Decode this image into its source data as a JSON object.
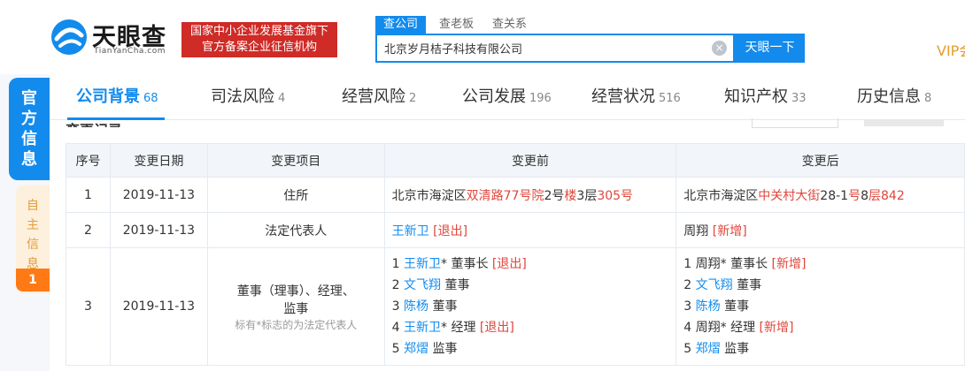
{
  "header": {
    "logo_text": "天眼查",
    "logo_sub": "TianYanCha.com",
    "badge_line1": "国家中小企业发展基金旗下",
    "badge_line2": "官方备案企业征信机构",
    "search_tabs": [
      "查公司",
      "查老板",
      "查关系"
    ],
    "search_value": "北京岁月桔子科技有限公司",
    "clear_icon": "×",
    "search_button": "天眼一下",
    "vip": "VIP会"
  },
  "side": {
    "official": [
      "官",
      "方",
      "信",
      "息"
    ],
    "self": [
      "自",
      "主",
      "信",
      "息"
    ],
    "self_count": "1"
  },
  "nav": [
    {
      "label": "公司背景",
      "count": "68"
    },
    {
      "label": "司法风险",
      "count": "4"
    },
    {
      "label": "经营风险",
      "count": "2"
    },
    {
      "label": "公司发展",
      "count": "196"
    },
    {
      "label": "经营状况",
      "count": "516"
    },
    {
      "label": "知识产权",
      "count": "33"
    },
    {
      "label": "历史信息",
      "count": "8"
    }
  ],
  "section_title": "变更记录",
  "table": {
    "headers": [
      "序号",
      "变更日期",
      "变更项目",
      "变更前",
      "变更后"
    ],
    "rows": [
      {
        "seq": "1",
        "date": "2019-11-13",
        "item": "住所",
        "before": [
          {
            "t": "北京市海淀区",
            "c": ""
          },
          {
            "t": "双清路77号院",
            "c": "red"
          },
          {
            "t": "2号",
            "c": ""
          },
          {
            "t": "楼",
            "c": "red"
          },
          {
            "t": "3层",
            "c": ""
          },
          {
            "t": "305号",
            "c": "red"
          }
        ],
        "after": [
          {
            "t": "北京市海淀区",
            "c": ""
          },
          {
            "t": "中关村大街",
            "c": "red"
          },
          {
            "t": "28-1",
            "c": ""
          },
          {
            "t": "号",
            "c": "red"
          },
          {
            "t": "8",
            "c": ""
          },
          {
            "t": "层",
            "c": "red"
          },
          {
            "t": "842",
            "c": "red"
          }
        ]
      },
      {
        "seq": "2",
        "date": "2019-11-13",
        "item": "法定代表人",
        "before_name": "王新卫",
        "before_tag": "[退出]",
        "after_name": "周翔",
        "after_tag": "[新增]"
      },
      {
        "seq": "3",
        "date": "2019-11-13",
        "item_line1": "董事（理事）、经理、",
        "item_line2": "监事",
        "item_note": "标有*标志的为法定代表人",
        "before_lines": [
          {
            "n": "1",
            "name": "王新卫",
            "name_blue": true,
            "role": "* 董事长",
            "tag": "[退出]"
          },
          {
            "n": "2",
            "name": "文飞翔",
            "name_blue": true,
            "role": " 董事",
            "tag": ""
          },
          {
            "n": "3",
            "name": "陈杨",
            "name_blue": true,
            "role": " 董事",
            "tag": ""
          },
          {
            "n": "4",
            "name": "王新卫",
            "name_blue": true,
            "role": "* 经理",
            "tag": "[退出]"
          },
          {
            "n": "5",
            "name": "郑熠",
            "name_blue": true,
            "role": " 监事",
            "tag": ""
          }
        ],
        "after_lines": [
          {
            "n": "1",
            "name": "周翔",
            "name_blue": false,
            "role": "* 董事长",
            "tag": "[新增]"
          },
          {
            "n": "2",
            "name": "文飞翔",
            "name_blue": true,
            "role": " 董事",
            "tag": ""
          },
          {
            "n": "3",
            "name": "陈杨",
            "name_blue": true,
            "role": " 董事",
            "tag": ""
          },
          {
            "n": "4",
            "name": "周翔",
            "name_blue": false,
            "role": "* 经理",
            "tag": "[新增]"
          },
          {
            "n": "5",
            "name": "郑熠",
            "name_blue": true,
            "role": " 监事",
            "tag": ""
          }
        ]
      }
    ]
  },
  "colors": {
    "brand_blue": "#128bed",
    "badge_red": "#cf2b27",
    "change_red": "#e0463b",
    "vip_gold": "#e39e2e",
    "self_orange": "#ff7a14"
  }
}
